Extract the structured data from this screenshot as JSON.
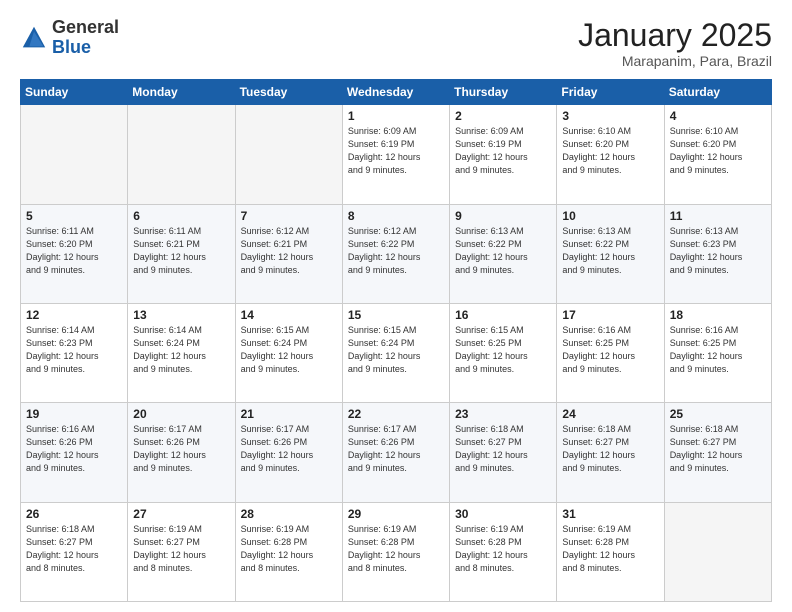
{
  "header": {
    "logo_general": "General",
    "logo_blue": "Blue",
    "month_title": "January 2025",
    "location": "Marapanim, Para, Brazil"
  },
  "weekdays": [
    "Sunday",
    "Monday",
    "Tuesday",
    "Wednesday",
    "Thursday",
    "Friday",
    "Saturday"
  ],
  "weeks": [
    [
      {
        "day": "",
        "info": ""
      },
      {
        "day": "",
        "info": ""
      },
      {
        "day": "",
        "info": ""
      },
      {
        "day": "1",
        "info": "Sunrise: 6:09 AM\nSunset: 6:19 PM\nDaylight: 12 hours\nand 9 minutes."
      },
      {
        "day": "2",
        "info": "Sunrise: 6:09 AM\nSunset: 6:19 PM\nDaylight: 12 hours\nand 9 minutes."
      },
      {
        "day": "3",
        "info": "Sunrise: 6:10 AM\nSunset: 6:20 PM\nDaylight: 12 hours\nand 9 minutes."
      },
      {
        "day": "4",
        "info": "Sunrise: 6:10 AM\nSunset: 6:20 PM\nDaylight: 12 hours\nand 9 minutes."
      }
    ],
    [
      {
        "day": "5",
        "info": "Sunrise: 6:11 AM\nSunset: 6:20 PM\nDaylight: 12 hours\nand 9 minutes."
      },
      {
        "day": "6",
        "info": "Sunrise: 6:11 AM\nSunset: 6:21 PM\nDaylight: 12 hours\nand 9 minutes."
      },
      {
        "day": "7",
        "info": "Sunrise: 6:12 AM\nSunset: 6:21 PM\nDaylight: 12 hours\nand 9 minutes."
      },
      {
        "day": "8",
        "info": "Sunrise: 6:12 AM\nSunset: 6:22 PM\nDaylight: 12 hours\nand 9 minutes."
      },
      {
        "day": "9",
        "info": "Sunrise: 6:13 AM\nSunset: 6:22 PM\nDaylight: 12 hours\nand 9 minutes."
      },
      {
        "day": "10",
        "info": "Sunrise: 6:13 AM\nSunset: 6:22 PM\nDaylight: 12 hours\nand 9 minutes."
      },
      {
        "day": "11",
        "info": "Sunrise: 6:13 AM\nSunset: 6:23 PM\nDaylight: 12 hours\nand 9 minutes."
      }
    ],
    [
      {
        "day": "12",
        "info": "Sunrise: 6:14 AM\nSunset: 6:23 PM\nDaylight: 12 hours\nand 9 minutes."
      },
      {
        "day": "13",
        "info": "Sunrise: 6:14 AM\nSunset: 6:24 PM\nDaylight: 12 hours\nand 9 minutes."
      },
      {
        "day": "14",
        "info": "Sunrise: 6:15 AM\nSunset: 6:24 PM\nDaylight: 12 hours\nand 9 minutes."
      },
      {
        "day": "15",
        "info": "Sunrise: 6:15 AM\nSunset: 6:24 PM\nDaylight: 12 hours\nand 9 minutes."
      },
      {
        "day": "16",
        "info": "Sunrise: 6:15 AM\nSunset: 6:25 PM\nDaylight: 12 hours\nand 9 minutes."
      },
      {
        "day": "17",
        "info": "Sunrise: 6:16 AM\nSunset: 6:25 PM\nDaylight: 12 hours\nand 9 minutes."
      },
      {
        "day": "18",
        "info": "Sunrise: 6:16 AM\nSunset: 6:25 PM\nDaylight: 12 hours\nand 9 minutes."
      }
    ],
    [
      {
        "day": "19",
        "info": "Sunrise: 6:16 AM\nSunset: 6:26 PM\nDaylight: 12 hours\nand 9 minutes."
      },
      {
        "day": "20",
        "info": "Sunrise: 6:17 AM\nSunset: 6:26 PM\nDaylight: 12 hours\nand 9 minutes."
      },
      {
        "day": "21",
        "info": "Sunrise: 6:17 AM\nSunset: 6:26 PM\nDaylight: 12 hours\nand 9 minutes."
      },
      {
        "day": "22",
        "info": "Sunrise: 6:17 AM\nSunset: 6:26 PM\nDaylight: 12 hours\nand 9 minutes."
      },
      {
        "day": "23",
        "info": "Sunrise: 6:18 AM\nSunset: 6:27 PM\nDaylight: 12 hours\nand 9 minutes."
      },
      {
        "day": "24",
        "info": "Sunrise: 6:18 AM\nSunset: 6:27 PM\nDaylight: 12 hours\nand 9 minutes."
      },
      {
        "day": "25",
        "info": "Sunrise: 6:18 AM\nSunset: 6:27 PM\nDaylight: 12 hours\nand 9 minutes."
      }
    ],
    [
      {
        "day": "26",
        "info": "Sunrise: 6:18 AM\nSunset: 6:27 PM\nDaylight: 12 hours\nand 8 minutes."
      },
      {
        "day": "27",
        "info": "Sunrise: 6:19 AM\nSunset: 6:27 PM\nDaylight: 12 hours\nand 8 minutes."
      },
      {
        "day": "28",
        "info": "Sunrise: 6:19 AM\nSunset: 6:28 PM\nDaylight: 12 hours\nand 8 minutes."
      },
      {
        "day": "29",
        "info": "Sunrise: 6:19 AM\nSunset: 6:28 PM\nDaylight: 12 hours\nand 8 minutes."
      },
      {
        "day": "30",
        "info": "Sunrise: 6:19 AM\nSunset: 6:28 PM\nDaylight: 12 hours\nand 8 minutes."
      },
      {
        "day": "31",
        "info": "Sunrise: 6:19 AM\nSunset: 6:28 PM\nDaylight: 12 hours\nand 8 minutes."
      },
      {
        "day": "",
        "info": ""
      }
    ]
  ]
}
